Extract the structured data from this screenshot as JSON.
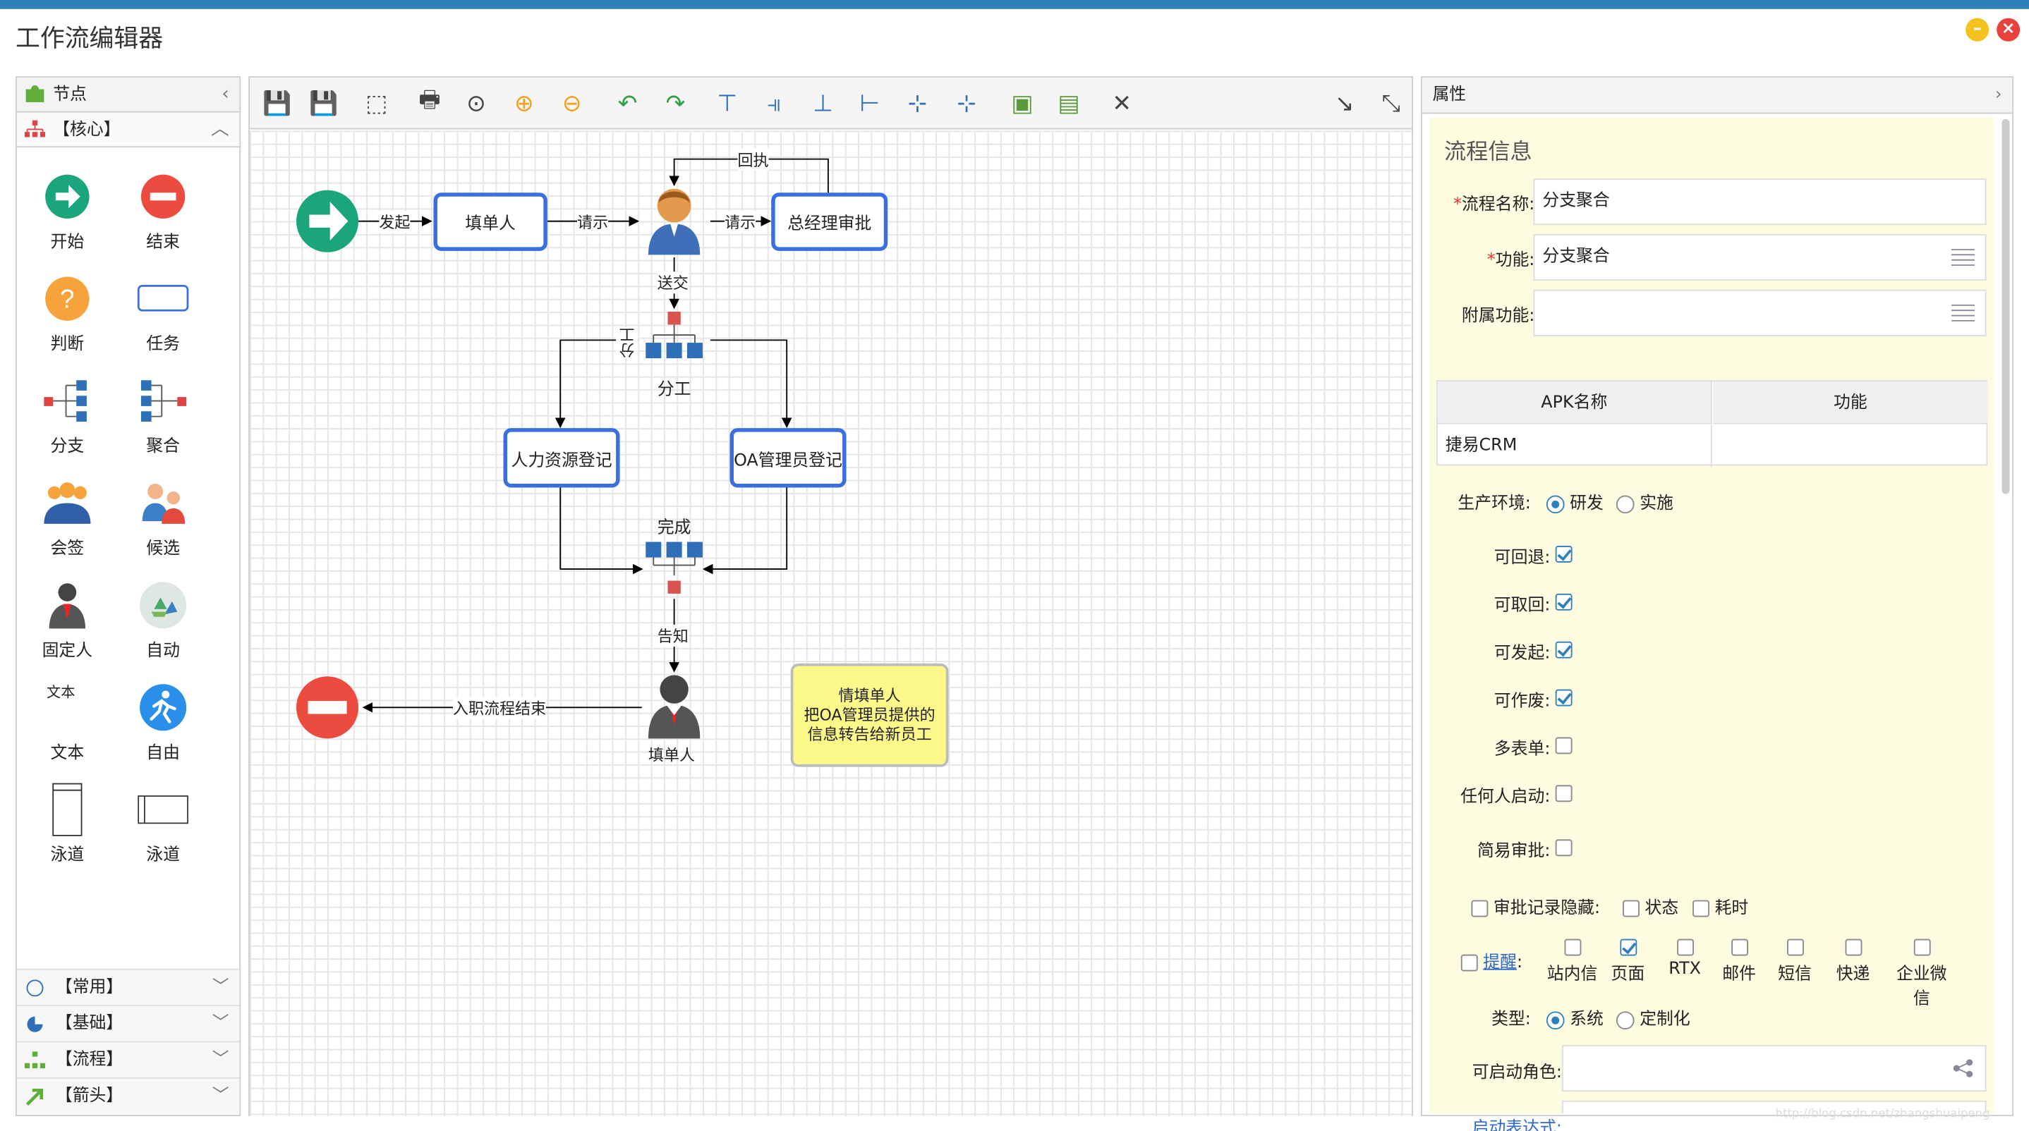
{
  "window": {
    "title": "工作流编辑器",
    "min_label": "–",
    "close_label": "×"
  },
  "left_panel": {
    "header": "节点",
    "core_section": "【核心】",
    "palette": [
      {
        "label": "开始",
        "icon": "start-arrow-icon"
      },
      {
        "label": "结束",
        "icon": "end-stop-icon"
      },
      {
        "label": "判断",
        "icon": "question-icon"
      },
      {
        "label": "任务",
        "icon": "task-rect-icon"
      },
      {
        "label": "分支",
        "icon": "branch-icon"
      },
      {
        "label": "聚合",
        "icon": "merge-icon"
      },
      {
        "label": "会签",
        "icon": "group-sign-icon"
      },
      {
        "label": "候选",
        "icon": "candidate-icon"
      },
      {
        "label": "固定人",
        "icon": "fixed-person-icon"
      },
      {
        "label": "自动",
        "icon": "auto-recycle-icon"
      },
      {
        "label": "文本",
        "icon": "text-icon",
        "icon_text": "文本"
      },
      {
        "label": "自由",
        "icon": "free-run-icon"
      },
      {
        "label": "泳道",
        "icon": "swimlane-vertical-icon"
      },
      {
        "label": "泳道",
        "icon": "swimlane-horizontal-icon"
      }
    ],
    "sections": [
      "【常用】",
      "【基础】",
      "【流程】",
      "【箭头】"
    ]
  },
  "toolbar": {
    "buttons": [
      "save-icon",
      "save-as-icon",
      "export-icon",
      "print-icon",
      "zoom-actual-icon",
      "zoom-in-icon",
      "zoom-out-icon",
      "undo-icon",
      "redo-icon",
      "align-top-icon",
      "align-right-icon",
      "align-bottom-icon",
      "align-left-icon",
      "align-center-h-icon",
      "align-center-v-icon",
      "bring-front-icon",
      "send-back-icon",
      "collapse-icon",
      "connector-straight-icon",
      "connector-dashed-icon"
    ]
  },
  "diagram": {
    "nodes": {
      "fill_person": "填单人",
      "gm_approve": "总经理审批",
      "hr_register": "人力资源登记",
      "oa_register": "OA管理员登记",
      "split_label": "分工",
      "join_label": "完成",
      "bottom_person": "填单人"
    },
    "edges": {
      "start": "发起",
      "request1": "请示",
      "request2": "请示",
      "reply": "回执",
      "send": "送交",
      "split": "分工",
      "notify": "告知",
      "end": "入职流程结束"
    },
    "note": [
      "情填单人",
      "把OA管理员提供的",
      "信息转告给新员工"
    ]
  },
  "properties": {
    "header": "属性",
    "section_title": "流程信息",
    "flow_name_label": "流程名称:",
    "flow_name_value": "分支聚合",
    "function_label": "功能:",
    "function_value": "分支聚合",
    "attached_label": "附属功能:",
    "attached_value": "",
    "table": {
      "col1": "APK名称",
      "col2": "功能",
      "row1_col1": "捷易CRM",
      "row1_col2": ""
    },
    "env_label": "生产环境:",
    "env_options": [
      "研发",
      "实施"
    ],
    "env_selected": "研发",
    "checks": [
      {
        "label": "可回退:",
        "checked": true
      },
      {
        "label": "可取回:",
        "checked": true
      },
      {
        "label": "可发起:",
        "checked": true
      },
      {
        "label": "可作废:",
        "checked": true
      },
      {
        "label": "多表单:",
        "checked": false
      },
      {
        "label": "任何人启动:",
        "checked": false
      },
      {
        "label": "简易审批:",
        "checked": false
      }
    ],
    "hide_label": "审批记录隐藏:",
    "hide_opts": [
      "状态",
      "耗时"
    ],
    "remind_label": "提醒",
    "remind_opts": [
      {
        "label": "站内信",
        "checked": false
      },
      {
        "label": "页面",
        "checked": true
      },
      {
        "label": "RTX",
        "checked": false
      },
      {
        "label": "邮件",
        "checked": false
      },
      {
        "label": "短信",
        "checked": false
      },
      {
        "label": "快递",
        "checked": false
      },
      {
        "label": "企业微信",
        "checked": false
      }
    ],
    "type_label": "类型:",
    "type_options": [
      "系统",
      "定制化"
    ],
    "type_selected": "系统",
    "role_label": "可启动角色:",
    "expr_label": "启动表达式:"
  },
  "watermark": "http://blog.csdn.net/zhangshuaipeng"
}
